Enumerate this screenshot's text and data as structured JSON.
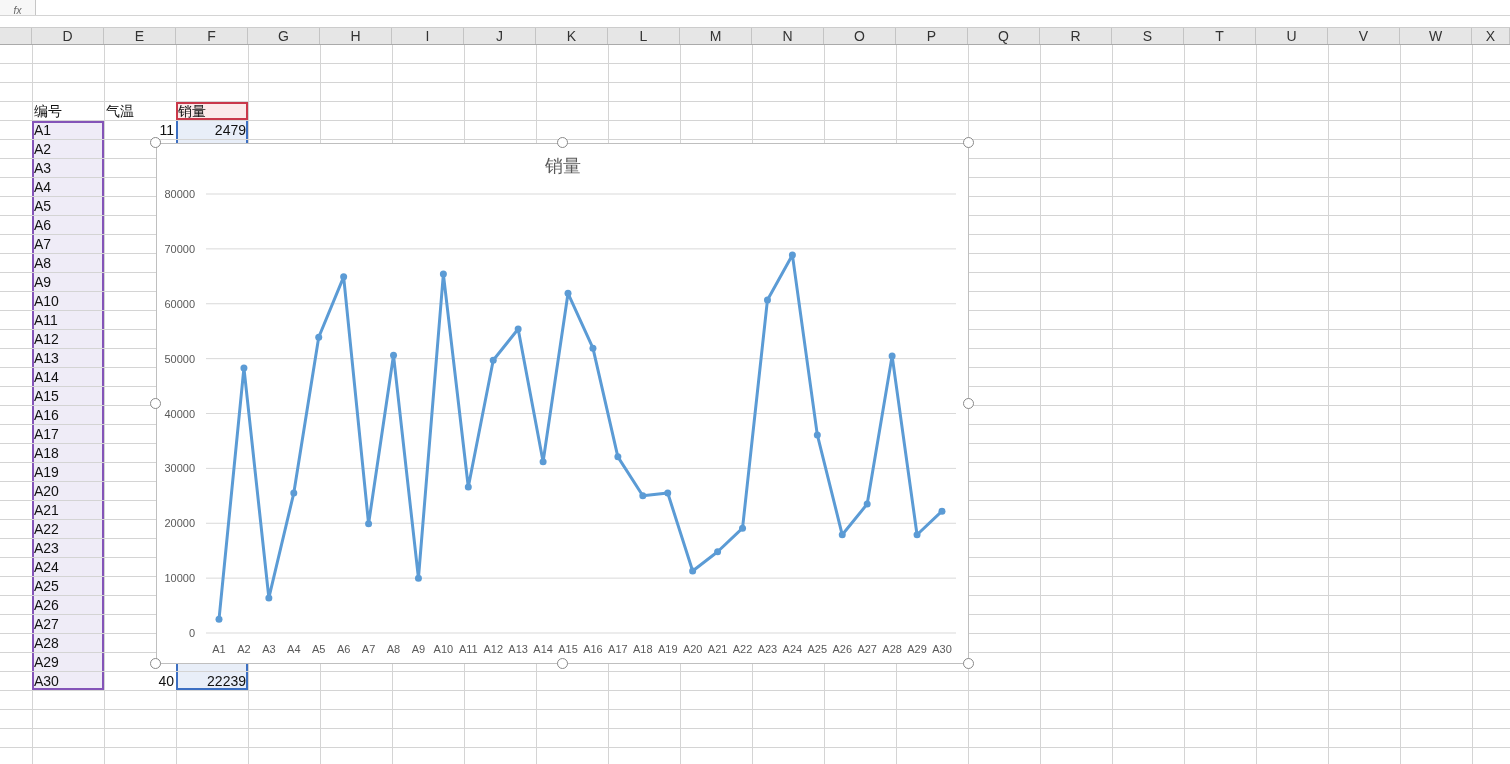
{
  "formula_bar": {
    "label": "fx"
  },
  "columns": [
    "D",
    "E",
    "F",
    "G",
    "H",
    "I",
    "J",
    "K",
    "L",
    "M",
    "N",
    "O",
    "P",
    "Q",
    "R",
    "S",
    "T",
    "U",
    "V",
    "W",
    "X"
  ],
  "table": {
    "headers": [
      "编号",
      "气温",
      "销量"
    ],
    "rows": [
      {
        "id": "A1",
        "temperature": "11",
        "sales": "2479"
      },
      {
        "id": "A2"
      },
      {
        "id": "A3"
      },
      {
        "id": "A4"
      },
      {
        "id": "A5"
      },
      {
        "id": "A6"
      },
      {
        "id": "A7"
      },
      {
        "id": "A8"
      },
      {
        "id": "A9"
      },
      {
        "id": "A10"
      },
      {
        "id": "A11"
      },
      {
        "id": "A12"
      },
      {
        "id": "A13"
      },
      {
        "id": "A14"
      },
      {
        "id": "A15"
      },
      {
        "id": "A16"
      },
      {
        "id": "A17"
      },
      {
        "id": "A18"
      },
      {
        "id": "A19"
      },
      {
        "id": "A20"
      },
      {
        "id": "A21"
      },
      {
        "id": "A22"
      },
      {
        "id": "A23"
      },
      {
        "id": "A24"
      },
      {
        "id": "A25"
      },
      {
        "id": "A26"
      },
      {
        "id": "A27"
      },
      {
        "id": "A28"
      },
      {
        "id": "A29"
      },
      {
        "id": "A30",
        "temperature": "40",
        "sales": "22239"
      }
    ]
  },
  "chart": {
    "chart_data": {
      "type": "line",
      "title": "销量",
      "categories": [
        "A1",
        "A2",
        "A3",
        "A4",
        "A5",
        "A6",
        "A7",
        "A8",
        "A9",
        "A10",
        "A11",
        "A12",
        "A13",
        "A14",
        "A15",
        "A16",
        "A17",
        "A18",
        "A19",
        "A20",
        "A21",
        "A22",
        "A23",
        "A24",
        "A25",
        "A26",
        "A27",
        "A28",
        "A29",
        "A30"
      ],
      "grid": true,
      "series": [
        {
          "color": "#5b9bd5",
          "marker": true,
          "values": [
            2500,
            48300,
            6400,
            25500,
            53900,
            64900,
            19900,
            50600,
            10000,
            65400,
            26600,
            49700,
            55400,
            31200,
            61900,
            51900,
            32100,
            25000,
            25500,
            11300,
            14800,
            19100,
            60700,
            68900,
            36100,
            17900,
            23500,
            50500,
            17900,
            22200
          ]
        }
      ],
      "ylim": [
        0,
        80000
      ],
      "yticks": [
        0,
        10000,
        20000,
        30000,
        40000,
        50000,
        60000,
        70000,
        80000
      ]
    }
  }
}
